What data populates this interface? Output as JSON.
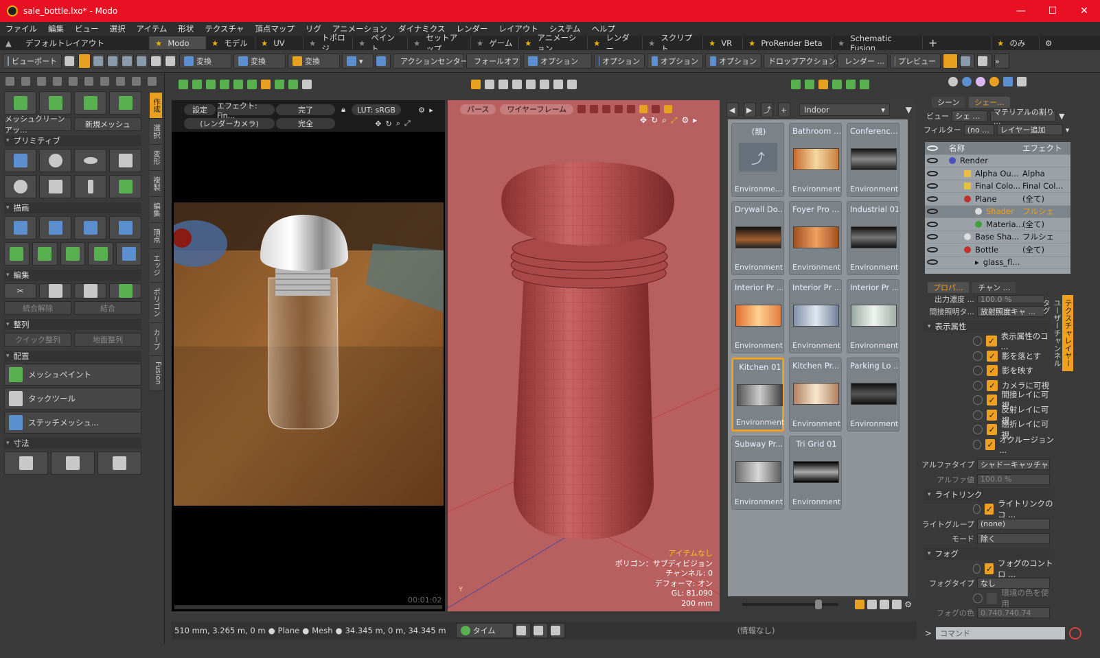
{
  "window": {
    "title": "sale_bottle.lxo* - Modo",
    "min": "—",
    "max": "☐",
    "close": "✕"
  },
  "menu": [
    "ファイル",
    "編集",
    "ビュー",
    "選択",
    "アイテム",
    "形状",
    "テクスチャ",
    "頂点マップ",
    "リグ",
    "アニメーション",
    "ダイナミクス",
    "レンダー",
    "レイアウト",
    "システム",
    "ヘルプ"
  ],
  "layout_tabs": {
    "default_layout": "デフォルトレイアウト",
    "tabs": [
      "Modo",
      "モデル",
      "UV",
      "トポロジ",
      "ペイント",
      "セットアップ",
      "ゲーム",
      "アニメーション",
      "レンダー",
      "スクリプト",
      "VR",
      "ProRender Beta",
      "Schematic Fusion"
    ],
    "plus": "+",
    "only": "のみ"
  },
  "toolbar": {
    "viewport": "ビューポート",
    "transform1": "変換",
    "transform2": "変換",
    "transform3": "変換",
    "action_center": "アクションセンター",
    "falloff": "フォールオフ",
    "option1": "オプション",
    "option2": "オプション",
    "option3": "オプション",
    "option4": "オプション",
    "drop_action": "ドロップアクション...",
    "render": "レンダー ...",
    "preview": "プレビュー"
  },
  "left_panel": {
    "mesh_cleanup": "メッシュクリーンアッ...",
    "new_mesh": "新規メッシュ",
    "sections": {
      "primitive": "プリミティブ",
      "draw": "描画",
      "edit": "編集",
      "align": "整列",
      "place": "配置",
      "dimension": "寸法"
    },
    "ungroup": "統合解除",
    "merge": "結合",
    "quick_align": "クイック整列",
    "ground_align": "地面整列",
    "mesh_paint": "メッシュペイント",
    "tack_tool": "タックツール",
    "stitch_mesh": "ステッチメッシュ..."
  },
  "vertical_tabs": [
    "作成",
    "選択",
    "変形",
    "複製",
    "編集",
    "頂点",
    "エッジ",
    "ポリゴン",
    "カーブ",
    "Fusion"
  ],
  "render_view": {
    "settings": "設定",
    "effect": "エフェクト: Fin...",
    "done": "完了",
    "lut": "LUT: sRGB",
    "camera": "(レンダーカメラ)",
    "complete": "完全",
    "time": "00:01:02"
  },
  "viewport3d": {
    "perspective": "パース",
    "wireframe": "ワイヤーフレーム",
    "info": {
      "no_item": "アイテムなし",
      "polygon": "ポリゴン：サブディビジョン",
      "channel": "チャンネル: 0",
      "deformer": "デフォーマ: オン",
      "gl": "GL: 81,090",
      "scale": "200 mm"
    }
  },
  "presets": {
    "folder": "Indoor",
    "items": [
      {
        "name": "(親)",
        "kind": "Environme..."
      },
      {
        "name": "Bathroom ...",
        "kind": "Environment"
      },
      {
        "name": "Conferenc...",
        "kind": "Environment"
      },
      {
        "name": "Drywall Do...",
        "kind": "Environment"
      },
      {
        "name": "Foyer Pro ...",
        "kind": "Environment"
      },
      {
        "name": "Industrial 01",
        "kind": "Environment"
      },
      {
        "name": "Interior Pr ...",
        "kind": "Environment"
      },
      {
        "name": "Interior Pr ...",
        "kind": "Environment"
      },
      {
        "name": "Interior Pr ...",
        "kind": "Environment"
      },
      {
        "name": "Kitchen 01",
        "kind": "Environment"
      },
      {
        "name": "Kitchen Pr...",
        "kind": "Environment"
      },
      {
        "name": "Parking Lo ...",
        "kind": "Environment"
      },
      {
        "name": "Subway Pr...",
        "kind": "Environment"
      },
      {
        "name": "Tri Grid 01",
        "kind": "Environment"
      }
    ]
  },
  "shader_tree": {
    "tabs": [
      "シーン",
      "シェー..."
    ],
    "view_label": "ビュー",
    "view_value": "シェ ...",
    "material_assign": "マテリアルの割り ...",
    "filter_label": "フィルター",
    "filter_value": "(no ...",
    "add_layer": "レイヤー追加",
    "col_name": "名称",
    "col_effect": "エフェクト",
    "rows": [
      {
        "name": "Render",
        "effect": ""
      },
      {
        "name": "Alpha Ou...",
        "effect": "Alpha"
      },
      {
        "name": "Final Colo...",
        "effect": "Final Col..."
      },
      {
        "name": "Plane",
        "effect": "(全て)"
      },
      {
        "name": "Shader",
        "effect": "フルシェ"
      },
      {
        "name": "Materia...",
        "effect": "(全て)"
      },
      {
        "name": "Base Sha...",
        "effect": "フルシェ"
      },
      {
        "name": "Bottle",
        "effect": "(全て)"
      },
      {
        "name": "glass_fl...",
        "effect": ""
      }
    ]
  },
  "properties": {
    "tabs": [
      "プロパ...",
      "チャン ..."
    ],
    "shadow_label": "出力濃度 ...",
    "shadow_value": "100.0 %",
    "indirect_label": "間接照明タ...",
    "indirect_value": "放射照度キャ ...",
    "visibility_section": "表示属性",
    "checks": [
      "表示属性のコ ...",
      "影を落とす",
      "影を映す",
      "カメラに可視",
      "間接レイに可視",
      "反射レイに可視",
      "屈折レイに可視",
      "オクルージョン ..."
    ],
    "alpha_type_label": "アルファタイプ",
    "alpha_type_value": "シャドーキャッチャ",
    "alpha_value_label": "アルファ値",
    "alpha_value": "100.0 %",
    "light_link_section": "ライトリンク",
    "light_link_check": "ライトリンクのコ ...",
    "light_group_label": "ライトグループ",
    "light_group_value": "(none)",
    "mode_label": "モード",
    "mode_value": "除く",
    "fog_section": "フォグ",
    "fog_check": "フォグのコントロ ...",
    "fog_type_label": "フォグタイプ",
    "fog_type_value": "なし",
    "env_color": "環境の色を使用",
    "fog_color_label": "フォグの色",
    "fog_color_value": "0.740.740.74"
  },
  "side_strip": [
    "テクスチャレイヤー",
    "ユーザーチャンネル",
    "タグ"
  ],
  "status": {
    "coords": "510 mm, 3.265 m, 0 m",
    "plane": "Plane",
    "mesh": "Mesh",
    "coords2": "34.345 m, 0 m, 34.345 m",
    "time": "タイム",
    "info": "(情報なし)"
  },
  "command": {
    "prompt": ">",
    "placeholder": "コマンド"
  }
}
